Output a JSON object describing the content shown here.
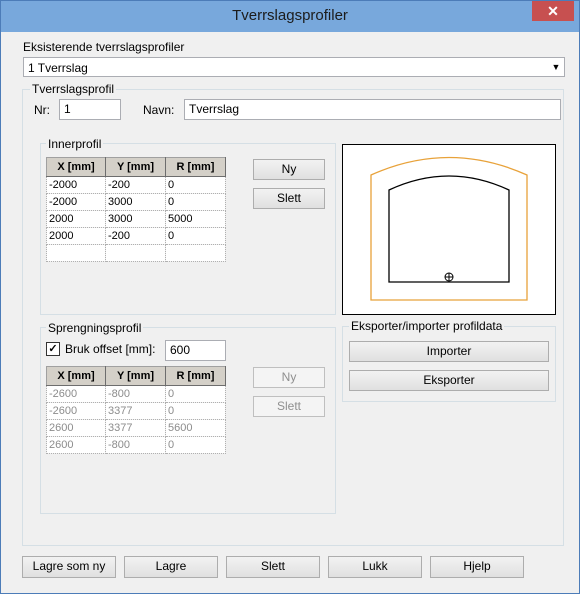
{
  "window": {
    "title": "Tverrslagsprofiler",
    "close_label": "✕"
  },
  "existing": {
    "label": "Eksisterende tverrslagsprofiler",
    "selected": "1 Tverrslag"
  },
  "profile": {
    "group_label": "Tverrslagsprofil",
    "nr_label": "Nr:",
    "nr_value": "1",
    "name_label": "Navn:",
    "name_value": "Tverrslag"
  },
  "inner": {
    "group_label": "Innerprofil",
    "columns": [
      "X [mm]",
      "Y [mm]",
      "R [mm]"
    ],
    "rows": [
      [
        "-2000",
        "-200",
        "0"
      ],
      [
        "-2000",
        "3000",
        "0"
      ],
      [
        "2000",
        "3000",
        "5000"
      ],
      [
        "2000",
        "-200",
        "0"
      ],
      [
        "",
        "",
        ""
      ]
    ],
    "new_label": "Ny",
    "delete_label": "Slett"
  },
  "blast": {
    "group_label": "Sprengningsprofil",
    "offset_label": "Bruk offset [mm]:",
    "offset_checked": true,
    "offset_value": "600",
    "columns": [
      "X [mm]",
      "Y [mm]",
      "R [mm]"
    ],
    "rows": [
      [
        "-2600",
        "-800",
        "0"
      ],
      [
        "-2600",
        "3377",
        "0"
      ],
      [
        "2600",
        "3377",
        "5600"
      ],
      [
        "2600",
        "-800",
        "0"
      ]
    ],
    "new_label": "Ny",
    "delete_label": "Slett"
  },
  "export": {
    "group_label": "Eksporter/importer profildata",
    "import_label": "Importer",
    "export_label": "Eksporter"
  },
  "footer": {
    "save_new": "Lagre som ny",
    "save": "Lagre",
    "delete": "Slett",
    "close": "Lukk",
    "help": "Hjelp"
  },
  "colors": {
    "outer_profile": "#e8a23a",
    "inner_profile": "#000000"
  },
  "icons": {
    "origin_marker": "crosshair-circle-icon",
    "dropdown": "chevron-down-icon",
    "checkbox": "checkmark-icon"
  }
}
